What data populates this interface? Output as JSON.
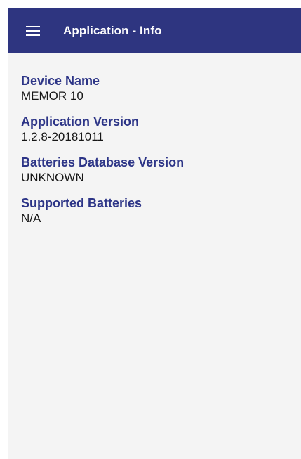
{
  "app_bar": {
    "menu_icon": "hamburger-menu-icon",
    "title": "Application - Info",
    "background_color": "#2e3580",
    "title_color": "#ffffff"
  },
  "info": {
    "items": [
      {
        "label": "Device Name",
        "value": "MEMOR 10"
      },
      {
        "label": "Application Version",
        "value": "1.2.8-20181011"
      },
      {
        "label": "Batteries Database Version",
        "value": "UNKNOWN"
      },
      {
        "label": "Supported Batteries",
        "value": "N/A"
      }
    ],
    "label_color": "#2d3587",
    "value_color": "#161616"
  }
}
